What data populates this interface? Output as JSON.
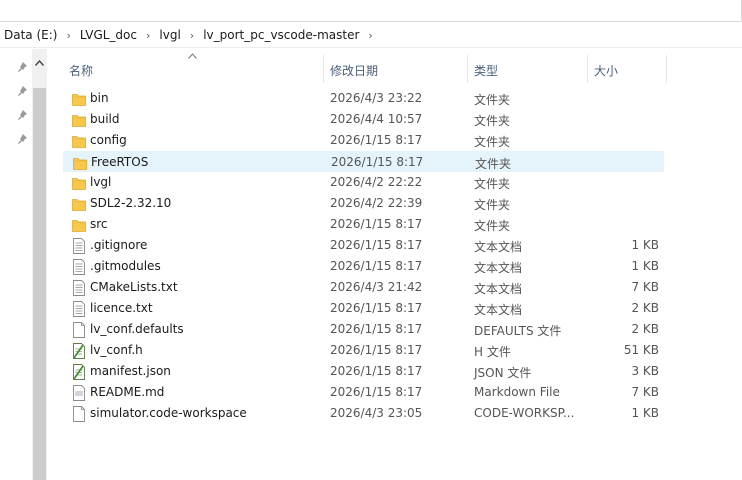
{
  "breadcrumb": [
    "Data (E:)",
    "LVGL_doc",
    "lvgl",
    "lv_port_pc_vscode-master"
  ],
  "breadcrumb_sep": "›",
  "columns": {
    "name": "名称",
    "date": "修改日期",
    "type": "类型",
    "size": "大小"
  },
  "files": [
    {
      "name": "bin",
      "date": "2026/4/3 23:22",
      "type": "文件夹",
      "size": "",
      "icon": "folder-icon"
    },
    {
      "name": "build",
      "date": "2026/4/4 10:57",
      "type": "文件夹",
      "size": "",
      "icon": "folder-icon"
    },
    {
      "name": "config",
      "date": "2026/1/15 8:17",
      "type": "文件夹",
      "size": "",
      "icon": "folder-icon"
    },
    {
      "name": "FreeRTOS",
      "date": "2026/1/15 8:17",
      "type": "文件夹",
      "size": "",
      "icon": "folder-icon",
      "hover": true
    },
    {
      "name": "lvgl",
      "date": "2026/4/2 22:22",
      "type": "文件夹",
      "size": "",
      "icon": "folder-icon"
    },
    {
      "name": "SDL2-2.32.10",
      "date": "2026/4/2 22:39",
      "type": "文件夹",
      "size": "",
      "icon": "folder-icon"
    },
    {
      "name": "src",
      "date": "2026/1/15 8:17",
      "type": "文件夹",
      "size": "",
      "icon": "folder-icon"
    },
    {
      "name": ".gitignore",
      "date": "2026/1/15 8:17",
      "type": "文本文档",
      "size": "1 KB",
      "icon": "text-file-icon"
    },
    {
      "name": ".gitmodules",
      "date": "2026/1/15 8:17",
      "type": "文本文档",
      "size": "1 KB",
      "icon": "text-file-icon"
    },
    {
      "name": "CMakeLists.txt",
      "date": "2026/4/3 21:42",
      "type": "文本文档",
      "size": "7 KB",
      "icon": "text-file-icon"
    },
    {
      "name": "licence.txt",
      "date": "2026/1/15 8:17",
      "type": "文本文档",
      "size": "2 KB",
      "icon": "text-file-icon"
    },
    {
      "name": "lv_conf.defaults",
      "date": "2026/1/15 8:17",
      "type": "DEFAULTS 文件",
      "size": "2 KB",
      "icon": "blank-file-icon"
    },
    {
      "name": "lv_conf.h",
      "date": "2026/1/15 8:17",
      "type": "H 文件",
      "size": "51 KB",
      "icon": "code-file-icon"
    },
    {
      "name": "manifest.json",
      "date": "2026/1/15 8:17",
      "type": "JSON 文件",
      "size": "3 KB",
      "icon": "code-file-icon"
    },
    {
      "name": "README.md",
      "date": "2026/1/15 8:17",
      "type": "Markdown File",
      "size": "7 KB",
      "icon": "markdown-file-icon"
    },
    {
      "name": "simulator.code-workspace",
      "date": "2026/4/3 23:05",
      "type": "CODE-WORKSP...",
      "size": "1 KB",
      "icon": "blank-file-icon"
    }
  ],
  "colors": {
    "hover": "#e5f3fb",
    "folder": "#f8c84a",
    "header_text": "#4c607a"
  }
}
